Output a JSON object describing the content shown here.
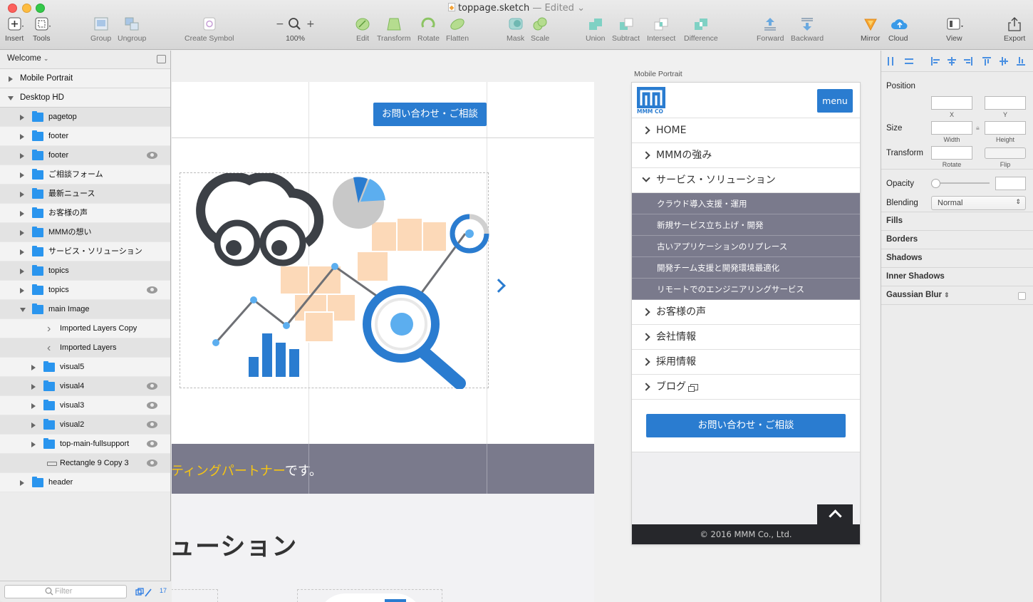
{
  "window": {
    "title": "toppage.sketch",
    "status": "— Edited",
    "status_arrow": "⌄"
  },
  "toolbar": {
    "items": [
      {
        "label": "Insert",
        "icon": "plus-square-icon"
      },
      {
        "label": "Tools",
        "icon": "tools-icon"
      },
      {
        "label": "Group",
        "icon": "group-icon"
      },
      {
        "label": "Ungroup",
        "icon": "ungroup-icon"
      },
      {
        "label": "Create Symbol",
        "icon": "symbol-icon"
      },
      {
        "label": "100%",
        "icon": "zoom-icon"
      },
      {
        "label": "Edit",
        "icon": "edit-icon"
      },
      {
        "label": "Transform",
        "icon": "transform-icon"
      },
      {
        "label": "Rotate",
        "icon": "rotate-icon"
      },
      {
        "label": "Flatten",
        "icon": "flatten-icon"
      },
      {
        "label": "Mask",
        "icon": "mask-icon"
      },
      {
        "label": "Scale",
        "icon": "scale-icon"
      },
      {
        "label": "Union",
        "icon": "union-icon"
      },
      {
        "label": "Subtract",
        "icon": "subtract-icon"
      },
      {
        "label": "Intersect",
        "icon": "intersect-icon"
      },
      {
        "label": "Difference",
        "icon": "difference-icon"
      },
      {
        "label": "Forward",
        "icon": "forward-icon"
      },
      {
        "label": "Backward",
        "icon": "backward-icon"
      },
      {
        "label": "Mirror",
        "icon": "mirror-icon"
      },
      {
        "label": "Cloud",
        "icon": "cloud-icon"
      },
      {
        "label": "View",
        "icon": "view-icon"
      },
      {
        "label": "Export",
        "icon": "export-icon"
      }
    ],
    "zoom_minus": "−",
    "zoom_plus": "+"
  },
  "sidebar": {
    "page_selector": "Welcome",
    "pages": [
      {
        "label": "Mobile Portrait",
        "expanded": false
      },
      {
        "label": "Desktop HD",
        "expanded": true
      }
    ],
    "layers": [
      {
        "label": "pagetop",
        "eye": false
      },
      {
        "label": "footer",
        "eye": false
      },
      {
        "label": "footer",
        "eye": true
      },
      {
        "label": "ご相談フォーム",
        "eye": false
      },
      {
        "label": "最新ニュース",
        "eye": false
      },
      {
        "label": "お客様の声",
        "eye": false
      },
      {
        "label": "MMMの想い",
        "eye": false
      },
      {
        "label": "サービス・ソリューション",
        "eye": false
      },
      {
        "label": "topics",
        "eye": false
      },
      {
        "label": "topics",
        "eye": true
      },
      {
        "label": "main Image",
        "eye": false
      },
      {
        "label": "Imported Layers Copy",
        "eye": false
      },
      {
        "label": "Imported Layers",
        "eye": false
      },
      {
        "label": "visual5",
        "eye": false
      },
      {
        "label": "visual4",
        "eye": true
      },
      {
        "label": "visual3",
        "eye": true
      },
      {
        "label": "visual2",
        "eye": true
      },
      {
        "label": "top-main-fullsupport",
        "eye": true
      },
      {
        "label": "Rectangle 9 Copy 3",
        "eye": true
      },
      {
        "label": "header",
        "eye": false
      }
    ],
    "filter_placeholder": "Filter",
    "filter_count": "17"
  },
  "canvas": {
    "desktop_cta": "お問い合わせ・ご相談",
    "banner_highlight": "ティングパートナー",
    "banner_rest": "です。",
    "section_heading": "ューション",
    "mobile_artboard_label": "Mobile Portrait",
    "mobile": {
      "logo_text": "MMM CO",
      "menu_button": "menu",
      "nav": [
        {
          "label": "HOME"
        },
        {
          "label": "MMMの強み"
        },
        {
          "label": "サービス・ソリューション"
        }
      ],
      "sub_items": [
        "クラウド導入支援・運用",
        "新規サービス立ち上げ・開発",
        "古いアプリケーションのリプレース",
        "開発チーム支援と開発環境最適化",
        "リモートでのエンジニアリングサービス"
      ],
      "nav2": [
        {
          "label": "お客様の声"
        },
        {
          "label": "会社情報"
        },
        {
          "label": "採用情報"
        },
        {
          "label": "ブログ"
        }
      ],
      "cta": "お問い合わせ・ご相談",
      "footer": "© 2016 MMM Co., Ltd."
    }
  },
  "inspector": {
    "position_label": "Position",
    "x_label": "X",
    "y_label": "Y",
    "size_label": "Size",
    "width_label": "Width",
    "height_label": "Height",
    "transform_label": "Transform",
    "rotate_label": "Rotate",
    "flip_label": "Flip",
    "opacity_label": "Opacity",
    "blending_label": "Blending",
    "blending_value": "Normal",
    "sections": [
      "Fills",
      "Borders",
      "Shadows",
      "Inner Shadows",
      "Gaussian Blur"
    ]
  },
  "colors": {
    "accent": "#2a7cd0",
    "banner": "#7a7a8c",
    "highlight": "#f6c514",
    "folder": "#2a95ee",
    "footer": "#26272b"
  }
}
